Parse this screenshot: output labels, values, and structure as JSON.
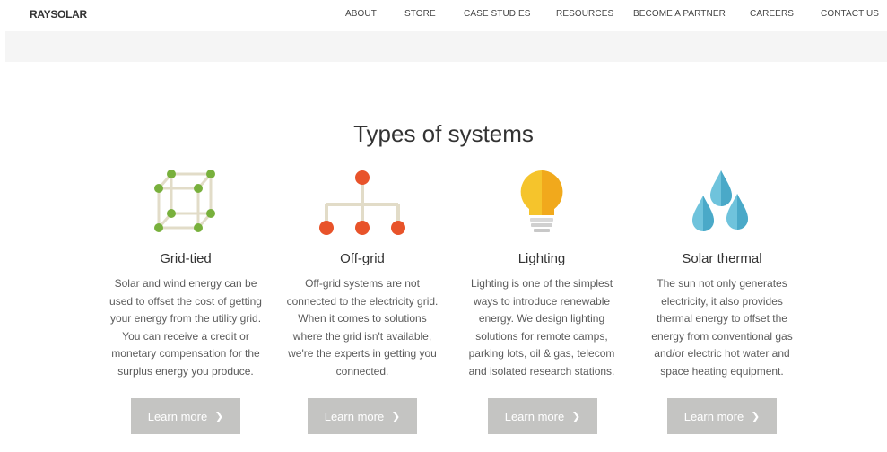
{
  "brand": {
    "logo_prefix": "RAYS",
    "logo_o": "O",
    "logo_suffix": "LAR"
  },
  "nav": [
    {
      "label": "ABOUT"
    },
    {
      "label": "STORE"
    },
    {
      "label": "CASE STUDIES"
    },
    {
      "label": "RESOURCES"
    },
    {
      "label": "BECOME A PARTNER"
    },
    {
      "label": "CAREERS"
    },
    {
      "label": "CONTACT US"
    }
  ],
  "section": {
    "title": "Types of systems",
    "items": [
      {
        "icon": "grid-cube-icon",
        "heading": "Grid-tied",
        "desc_lines": [
          "Solar and wind energy can be",
          "used to offset the cost of getting",
          "your energy from the utility grid.",
          "You can receive a credit or",
          "monetary compensation for the",
          "surplus energy you produce."
        ],
        "button": "Learn more",
        "button_chevron": "❯"
      },
      {
        "icon": "off-grid-network-icon",
        "heading": "Off-grid",
        "desc_lines": [
          "Off-grid systems are not",
          "connected to the electricity grid.",
          "When it comes to solutions",
          "where the grid isn't available,",
          "we're the experts in getting you",
          "connected."
        ],
        "button": "Learn more",
        "button_chevron": "❯"
      },
      {
        "icon": "light-bulb-icon",
        "heading": "Lighting",
        "desc_lines": [
          "Lighting is one of the simplest",
          "ways to introduce renewable",
          "energy. We design lighting",
          "solutions for remote camps,",
          "parking lots, oil & gas, telecom",
          "and isolated research stations."
        ],
        "button": "Learn more",
        "button_chevron": "❯"
      },
      {
        "icon": "water-drops-icon",
        "heading": "Solar thermal",
        "desc_lines": [
          "The sun not only generates",
          "electricity, it also provides",
          "thermal energy to offset the",
          "energy from conventional gas",
          "and/or electric hot water and",
          "space heating equipment."
        ],
        "button": "Learn more",
        "button_chevron": "❯"
      }
    ]
  },
  "colors": {
    "green": "#78b03c",
    "orange": "#e8532a",
    "yellow": "#f5c42c",
    "blue": "#6fc3dc",
    "button_bg": "#c4c4c2"
  }
}
